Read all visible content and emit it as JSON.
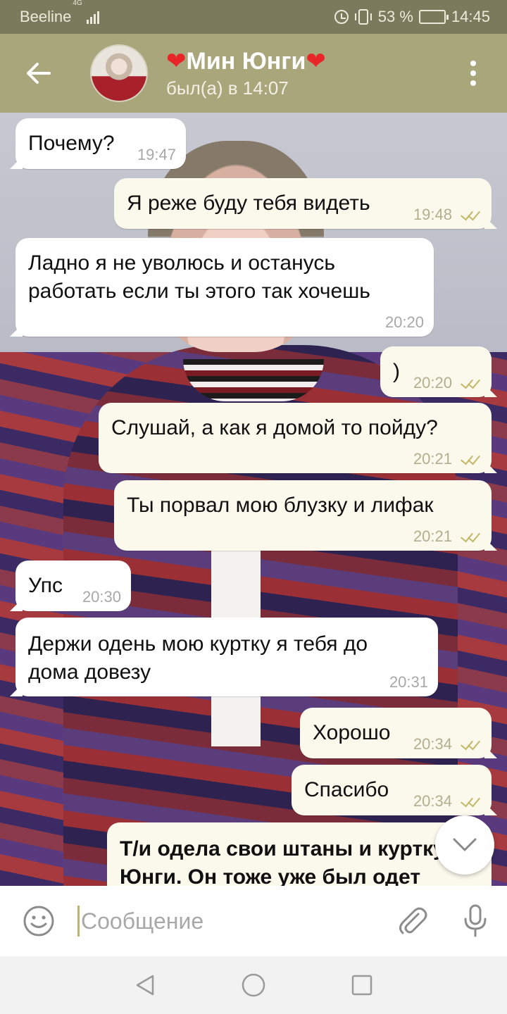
{
  "status_bar": {
    "carrier": "Beeline",
    "network": "4G",
    "battery": "53 %",
    "battery_level": 0.53,
    "time": "14:45"
  },
  "header": {
    "heart_left": "❤",
    "contact_name": "Мин Юнги",
    "heart_right": "❤",
    "last_seen": "был(а) в 14:07",
    "icons": {
      "back": "arrow-left-icon",
      "menu": "more-vertical-icon"
    }
  },
  "messages": [
    {
      "dir": "in",
      "text": "Почему?",
      "time": "19:47"
    },
    {
      "dir": "out",
      "text": "Я реже буду тебя видеть",
      "time": "19:48"
    },
    {
      "dir": "in",
      "text": "Ладно я не уволюсь и останусь работать если ты этого так хочешь",
      "time": "20:20"
    },
    {
      "dir": "out",
      "text": ")",
      "time": "20:20"
    },
    {
      "dir": "out",
      "text": "Слушай, а как я домой то пойду?",
      "time": "20:21"
    },
    {
      "dir": "out",
      "text": "Ты порвал мою блузку и лифак",
      "time": "20:21"
    },
    {
      "dir": "in",
      "text": "Упс",
      "time": "20:30"
    },
    {
      "dir": "in",
      "text": "Держи одень мою куртку я тебя до дома довезу",
      "time": "20:31"
    },
    {
      "dir": "out",
      "text": "Хорошо",
      "time": "20:34"
    },
    {
      "dir": "out",
      "text": "Спасибо",
      "time": "20:34"
    },
    {
      "dir": "out",
      "text": "Т/и одела свои штаны и куртку Юнги. Он тоже уже был одет",
      "time": ""
    }
  ],
  "composer": {
    "placeholder": "Сообщение",
    "icons": {
      "emoji": "smile-icon",
      "attach": "paperclip-icon",
      "mic": "microphone-icon"
    }
  },
  "scroll_down_icon": "chevron-down-icon",
  "nav": {
    "icons": [
      "back-triangle-icon",
      "home-circle-icon",
      "recents-square-icon"
    ]
  },
  "colors": {
    "app_bar": "#aaa67c",
    "status_bar": "#7c7a5c",
    "outgoing_bubble": "#fbf8ec",
    "incoming_bubble": "#ffffff",
    "read_ticks": "#c4b96a"
  }
}
